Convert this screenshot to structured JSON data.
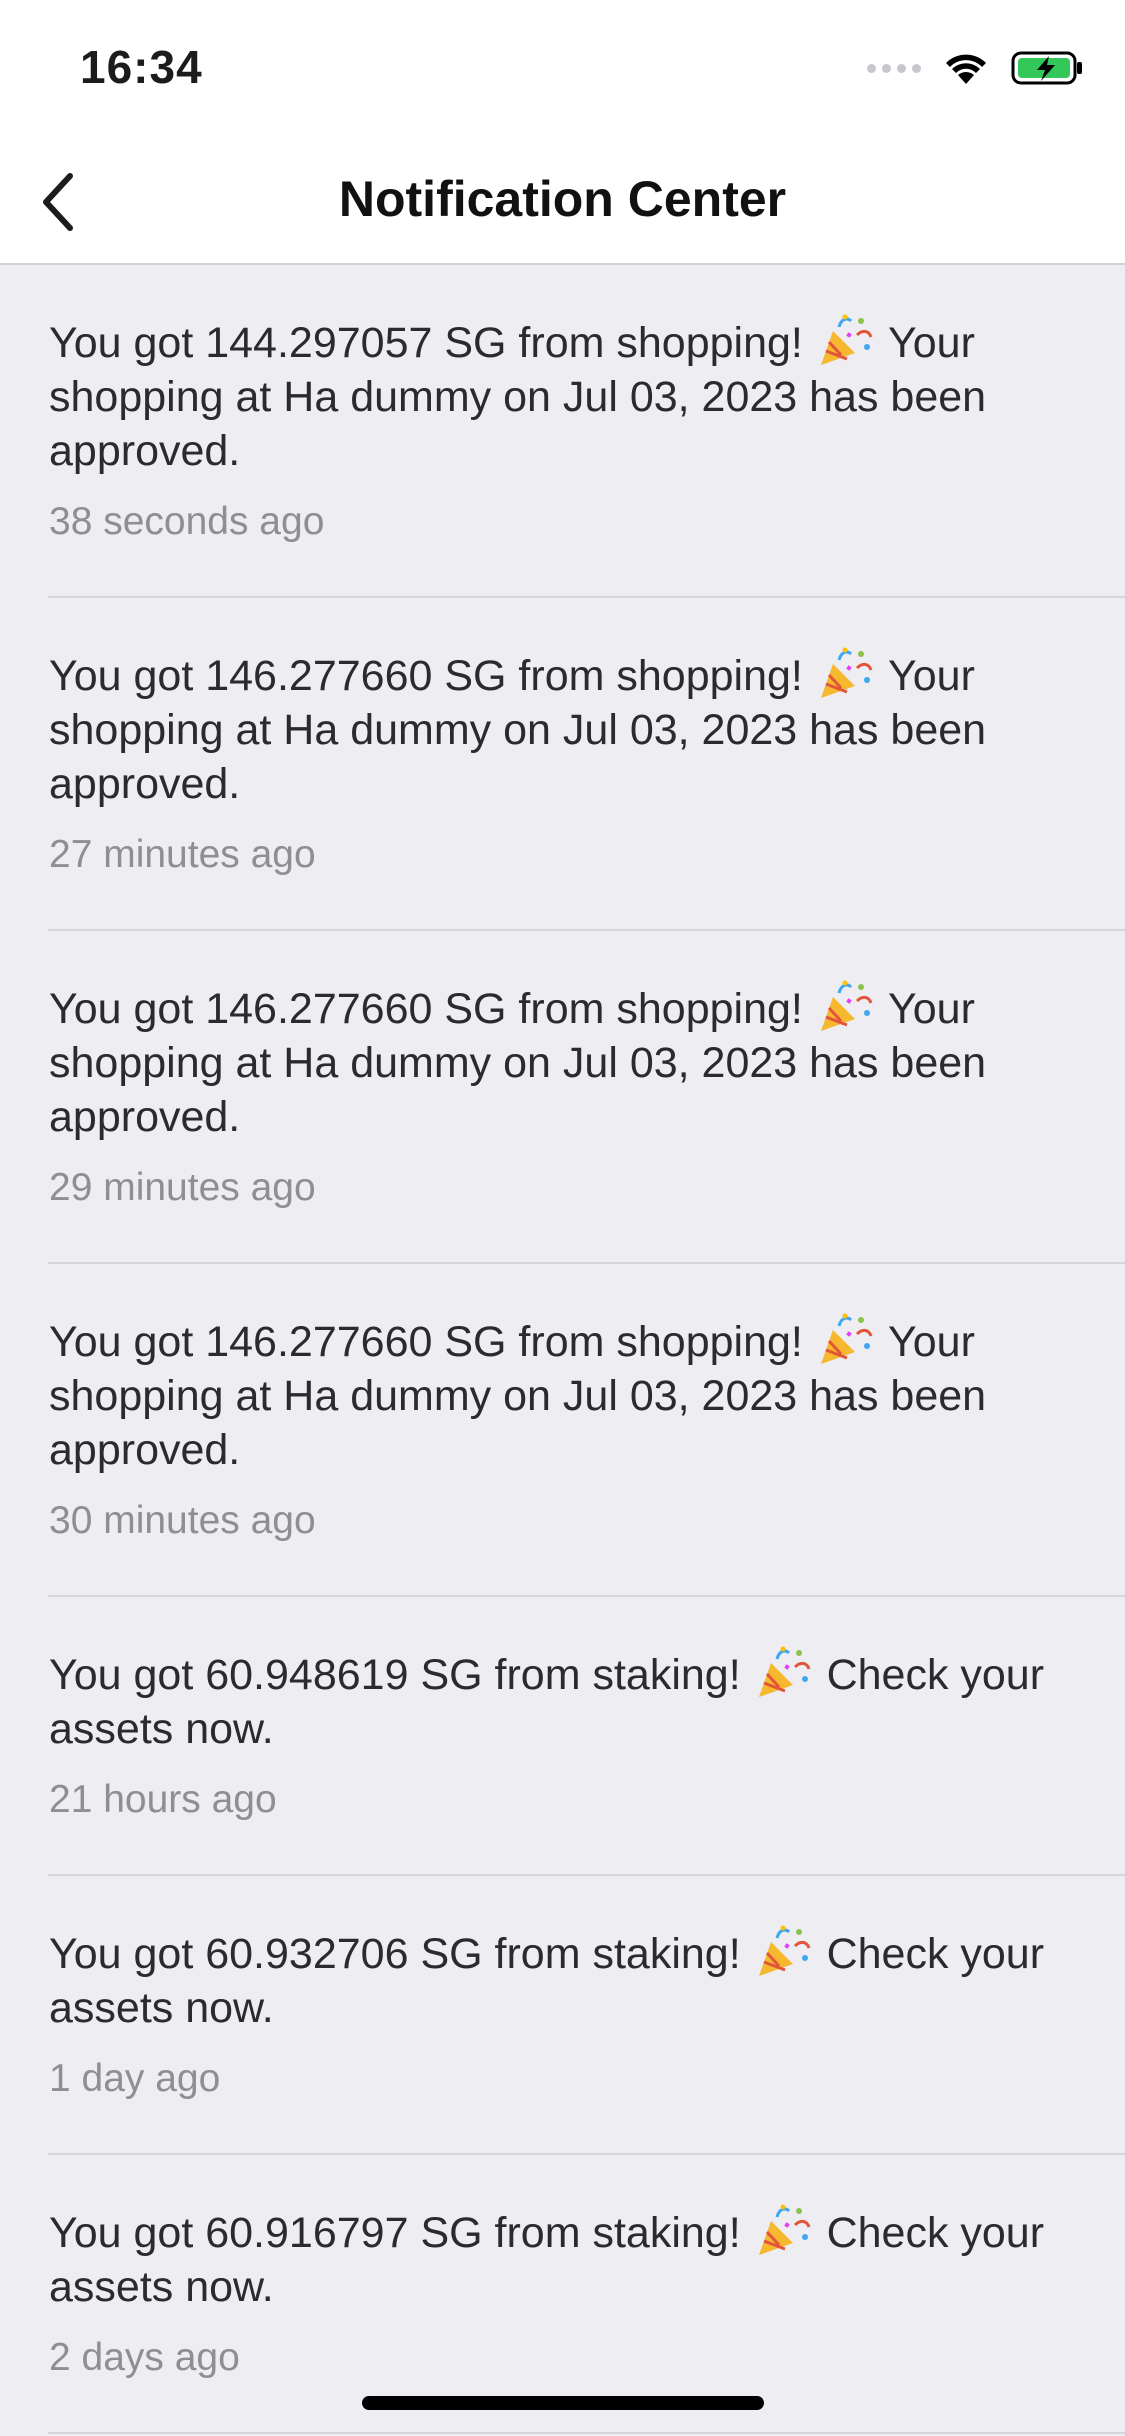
{
  "status_bar": {
    "time": "16:34",
    "icons": [
      "signal-dots-icon",
      "wifi-icon",
      "battery-charging-icon"
    ],
    "battery_color": "#34C759"
  },
  "header": {
    "title": "Notification Center",
    "back_icon": "chevron-left-icon"
  },
  "notifications": [
    {
      "before": "You got 144.297057 SG from shopping!",
      "after": "Your shopping at Ha dummy on Jul 03, 2023 has been approved.",
      "time": "38 seconds ago",
      "emoji": "party-popper-icon"
    },
    {
      "before": "You got 146.277660 SG from shopping!",
      "after": "Your shopping at Ha dummy on Jul 03, 2023 has been approved.",
      "time": "27 minutes ago",
      "emoji": "party-popper-icon"
    },
    {
      "before": "You got 146.277660 SG from shopping!",
      "after": "Your shopping at Ha dummy on Jul 03, 2023 has been approved.",
      "time": "29 minutes ago",
      "emoji": "party-popper-icon"
    },
    {
      "before": "You got 146.277660 SG from shopping!",
      "after": "Your shopping at Ha dummy on Jul 03, 2023 has been approved.",
      "time": "30 minutes ago",
      "emoji": "party-popper-icon"
    },
    {
      "before": "You got 60.948619 SG from staking!",
      "after": "Check your assets now.",
      "time": "21 hours ago",
      "emoji": "party-popper-icon"
    },
    {
      "before": "You got 60.932706 SG from staking!",
      "after": "Check your assets now.",
      "time": "1 day ago",
      "emoji": "party-popper-icon"
    },
    {
      "before": "You got 60.916797 SG from staking!",
      "after": "Check your assets now.",
      "time": "2 days ago",
      "emoji": "party-popper-icon"
    }
  ]
}
